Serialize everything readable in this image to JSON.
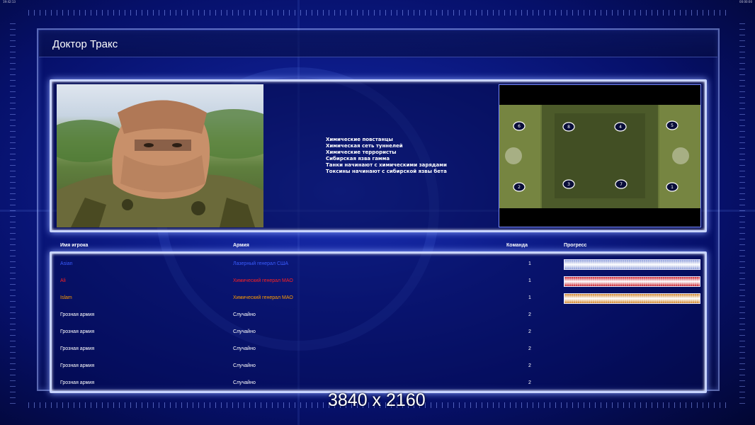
{
  "system_bar": {
    "left_text": "19:42:13",
    "right_text": "00:00:00"
  },
  "title": "Доктор Тракс",
  "briefing_lines": [
    "Химические повстанцы",
    "Химическая сеть туннелей",
    "Химические террористы",
    "Сибирская язва гамма",
    "Танки начинают с химическими зарядами",
    "Токсины начинают с сибирской язвы бета"
  ],
  "map": {
    "player_starts": [
      "6",
      "8",
      "4",
      "5",
      "2",
      "3",
      "7",
      "1"
    ]
  },
  "table": {
    "headers": {
      "player_name": "Имя игрока",
      "army": "Армия",
      "team": "Команда",
      "progress": "Прогресс"
    },
    "rows": [
      {
        "name": "Asian",
        "army": "Лазерный генерал США",
        "team": "1",
        "color": "#3a5cff",
        "progress": 1.0,
        "progress_color": "#8c9cd8"
      },
      {
        "name": "Ali",
        "army": "Химический генерал МАО",
        "team": "1",
        "color": "#ff2020",
        "progress": 1.0,
        "progress_color": "#c8202c"
      },
      {
        "name": "Islam",
        "army": "Химический генерал МАО",
        "team": "1",
        "color": "#ff9c00",
        "progress": 1.0,
        "progress_color": "#d08428"
      },
      {
        "name": "Грозная армия",
        "army": "Случайно",
        "team": "2",
        "color": "#ffffff"
      },
      {
        "name": "Грозная армия",
        "army": "Случайно",
        "team": "2",
        "color": "#ffffff"
      },
      {
        "name": "Грозная армия",
        "army": "Случайно",
        "team": "2",
        "color": "#ffffff"
      },
      {
        "name": "Грозная армия",
        "army": "Случайно",
        "team": "2",
        "color": "#ffffff"
      },
      {
        "name": "Грозная армия",
        "army": "Случайно",
        "team": "2",
        "color": "#ffffff"
      }
    ]
  },
  "watermark": "3840 x 2160"
}
